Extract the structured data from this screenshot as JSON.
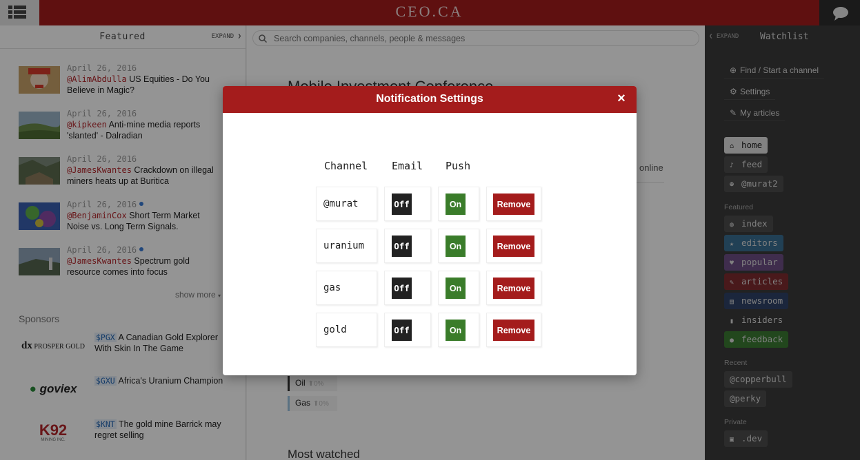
{
  "brand": {
    "logo": "CEO.CA"
  },
  "left": {
    "title": "Featured",
    "expand": "EXPAND",
    "items": [
      {
        "date": "April 26, 2016",
        "user": "@AlimAbdulla",
        "text": "US Equities - Do You Believe in Magic?",
        "dot": false
      },
      {
        "date": "April 26, 2016",
        "user": "@kipkeen",
        "text": "Anti-mine media reports 'slanted' - Dalradian",
        "dot": false
      },
      {
        "date": "April 26, 2016",
        "user": "@JamesKwantes",
        "text": "Crackdown on illegal miners heats up at Buritica",
        "dot": false
      },
      {
        "date": "April 26, 2016",
        "user": "@BenjaminCox",
        "text": "Short Term Market Noise vs. Long Term Signals.",
        "dot": true
      },
      {
        "date": "April 26, 2016",
        "user": "@JamesKwantes",
        "text": "Spectrum gold resource comes into focus",
        "dot": true
      }
    ],
    "show_more": "show more",
    "sponsors_title": "Sponsors",
    "sponsors": [
      {
        "logo": "PROSPER GOLD",
        "ticker": "$PGX",
        "text": "A Canadian Gold Explorer With Skin In The Game"
      },
      {
        "logo": "goviex",
        "ticker": "$GXU",
        "text": "Africa's Uranium Champion"
      },
      {
        "logo": "K92",
        "logo_sub": "MINING INC.",
        "ticker": "$KNT",
        "text": "The gold mine Barrick may regret selling"
      }
    ]
  },
  "center": {
    "search_placeholder": "Search companies, channels, people & messages",
    "title": "Mobile Investment Conference",
    "online": "online",
    "commodities": [
      {
        "name": "Oil",
        "change": "0%"
      },
      {
        "name": "Gas",
        "change": "0%"
      }
    ],
    "most_watched": "Most watched"
  },
  "right": {
    "expand": "EXPAND",
    "title": "Watchlist",
    "links": [
      {
        "label": "Find / Start a channel"
      },
      {
        "label": "Settings"
      },
      {
        "label": "My articles"
      }
    ],
    "pills_top": [
      {
        "label": "home"
      },
      {
        "label": "feed"
      },
      {
        "label": "@murat2"
      }
    ],
    "featured_label": "Featured",
    "pills_featured": [
      {
        "label": "index",
        "color": "#4c4c4c"
      },
      {
        "label": "editors",
        "color": "#3a6f93"
      },
      {
        "label": "popular",
        "color": "#6d4f86"
      },
      {
        "label": "articles",
        "color": "#7e2b30"
      },
      {
        "label": "newsroom",
        "color": "#2f4268"
      },
      {
        "label": "insiders",
        "color": "#3b3b3b"
      },
      {
        "label": "feedback",
        "color": "#3c7a33"
      }
    ],
    "recent_label": "Recent",
    "pills_recent": [
      {
        "label": "@copperbull"
      },
      {
        "label": "@perky"
      }
    ],
    "private_label": "Private",
    "pills_private": [
      {
        "label": ".dev"
      }
    ]
  },
  "modal": {
    "title": "Notification Settings",
    "close": "×",
    "headers": {
      "channel": "Channel",
      "email": "Email",
      "push": "Push"
    },
    "rows": [
      {
        "channel": "@murat",
        "email": "Off",
        "push": "On",
        "remove": "Remove"
      },
      {
        "channel": "uranium",
        "email": "Off",
        "push": "On",
        "remove": "Remove"
      },
      {
        "channel": "gas",
        "email": "Off",
        "push": "On",
        "remove": "Remove"
      },
      {
        "channel": "gold",
        "email": "Off",
        "push": "On",
        "remove": "Remove"
      }
    ]
  }
}
